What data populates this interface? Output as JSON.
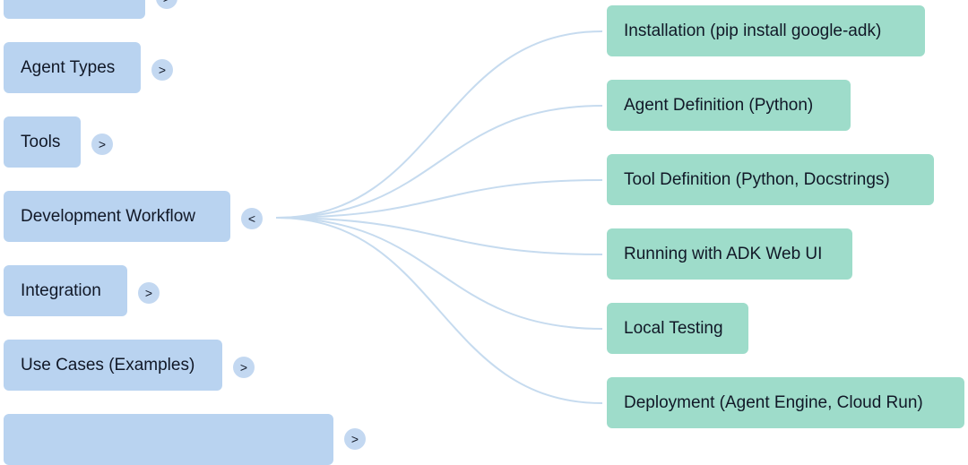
{
  "left_nodes": [
    {
      "label": "",
      "toggle": ">"
    },
    {
      "label": "Agent Types",
      "toggle": ">"
    },
    {
      "label": "Tools",
      "toggle": ">"
    },
    {
      "label": "Development Workflow",
      "toggle": "<"
    },
    {
      "label": "Integration",
      "toggle": ">"
    },
    {
      "label": "Use Cases (Examples)",
      "toggle": ">"
    },
    {
      "label": "",
      "toggle": ">"
    }
  ],
  "right_nodes": [
    {
      "label": "Installation (pip install google-adk)"
    },
    {
      "label": "Agent Definition (Python)"
    },
    {
      "label": "Tool Definition (Python, Docstrings)"
    },
    {
      "label": "Running with ADK Web UI"
    },
    {
      "label": "Local Testing"
    },
    {
      "label": "Deployment (Agent Engine, Cloud Run)"
    }
  ],
  "colors": {
    "left_node_bg": "#b9d3f0",
    "right_node_bg": "#9edcca",
    "toggle_bg": "#c3d8f1",
    "connector": "#c6dbef"
  }
}
